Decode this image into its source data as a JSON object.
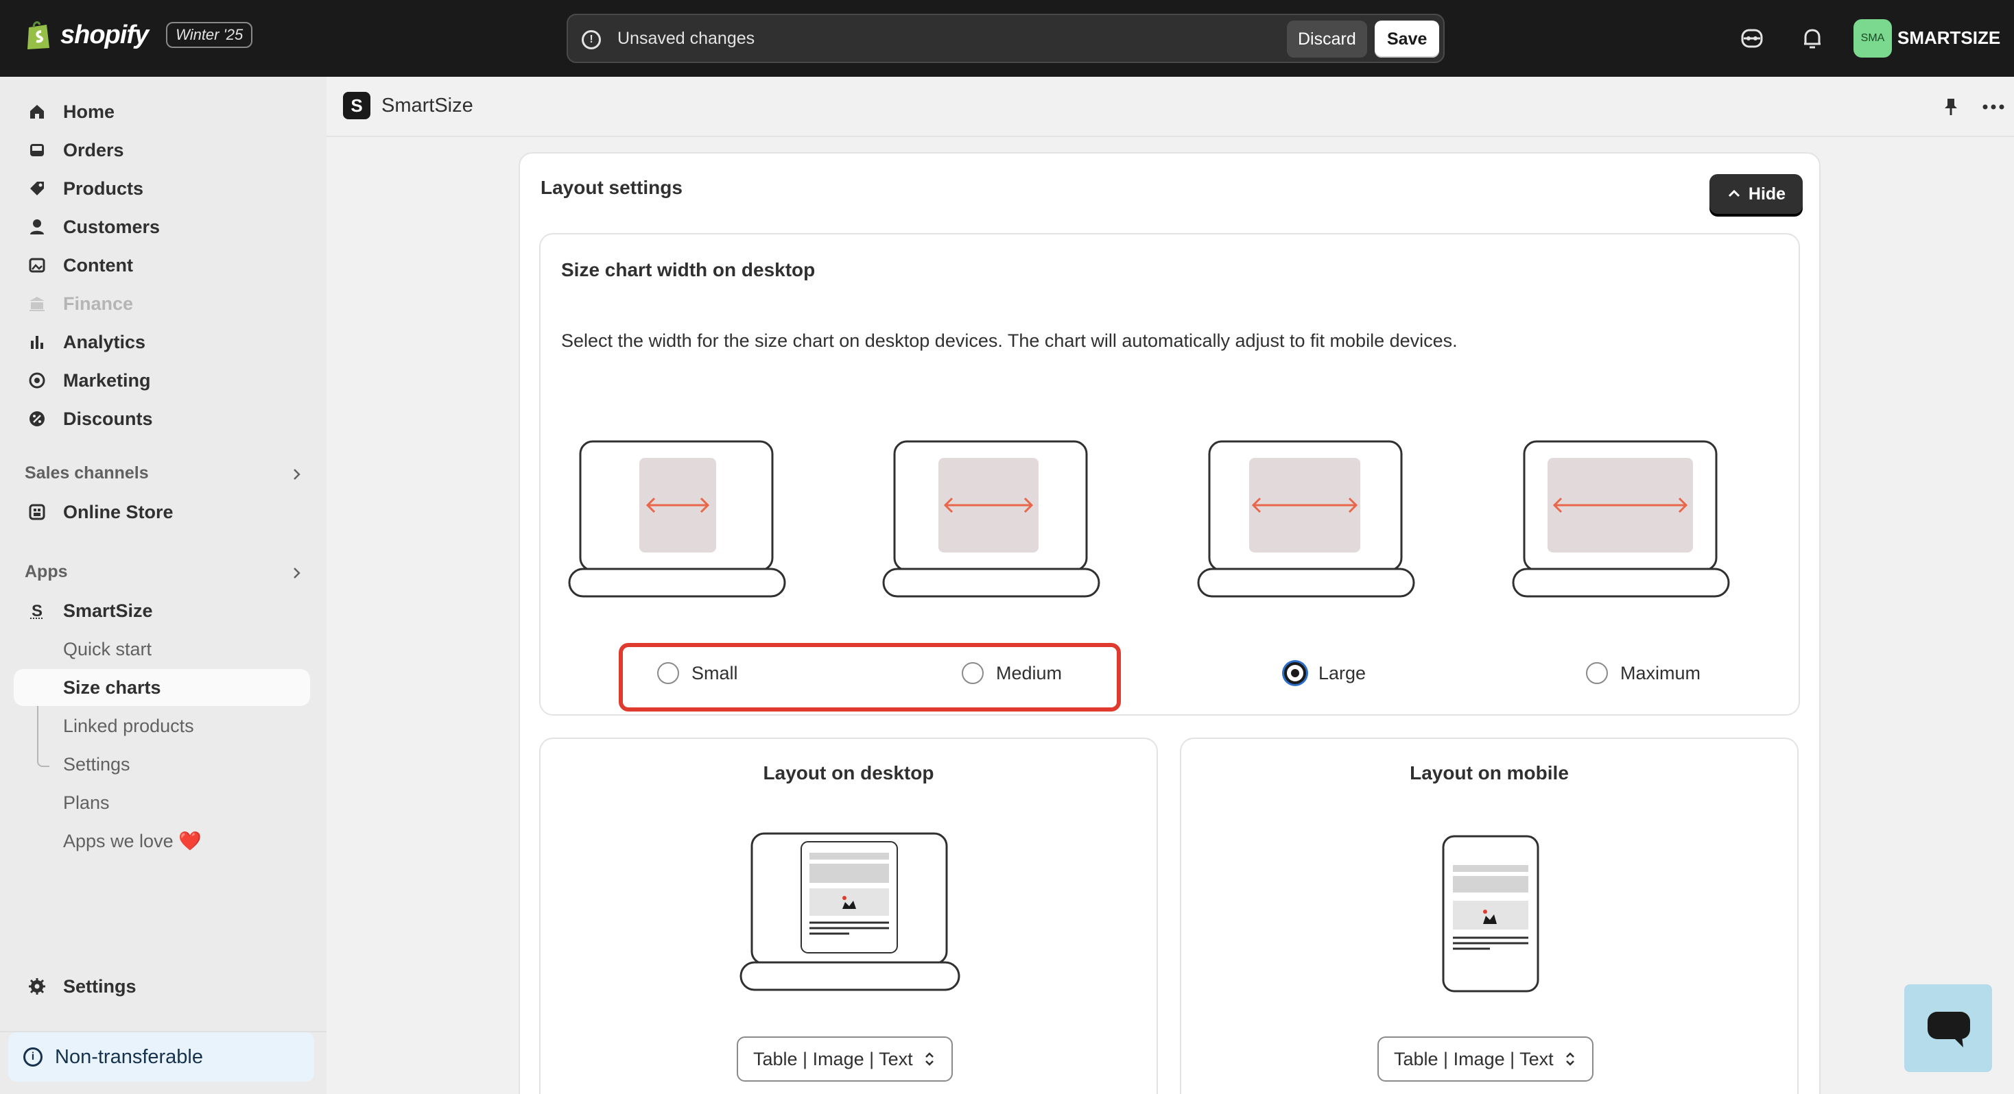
{
  "topbar": {
    "brand": "shopify",
    "edition_badge": "Winter '25",
    "unsaved_text": "Unsaved changes",
    "discard_label": "Discard",
    "save_label": "Save",
    "avatar_initials": "SMA",
    "store_name": "SMARTSIZE"
  },
  "sidebar": {
    "main_items": [
      {
        "label": "Home",
        "icon": "home-icon"
      },
      {
        "label": "Orders",
        "icon": "inbox-icon"
      },
      {
        "label": "Products",
        "icon": "tag-icon"
      },
      {
        "label": "Customers",
        "icon": "person-icon"
      },
      {
        "label": "Content",
        "icon": "image-icon"
      },
      {
        "label": "Finance",
        "icon": "bank-icon",
        "disabled": true
      },
      {
        "label": "Analytics",
        "icon": "bar-chart-icon"
      },
      {
        "label": "Marketing",
        "icon": "target-icon"
      },
      {
        "label": "Discounts",
        "icon": "discount-icon"
      }
    ],
    "sales_channels_heading": "Sales channels",
    "online_store_label": "Online Store",
    "apps_heading": "Apps",
    "app_name": "SmartSize",
    "app_subitems": [
      "Quick start",
      "Size charts",
      "Linked products",
      "Settings",
      "Plans",
      "Apps we love ❤️"
    ],
    "active_subitem": "Size charts",
    "settings_label": "Settings",
    "non_transferable_label": "Non-transferable"
  },
  "appbar": {
    "title": "SmartSize"
  },
  "layout_settings": {
    "title": "Layout settings",
    "hide_label": "Hide",
    "width_card": {
      "title": "Size chart width on desktop",
      "description": "Select the width for the size chart on desktop devices. The chart will automatically adjust to fit mobile devices.",
      "options": [
        "Small",
        "Medium",
        "Large",
        "Maximum"
      ],
      "selected": "Large"
    },
    "desktop_card": {
      "title": "Layout on desktop",
      "select_value": "Table | Image | Text"
    },
    "mobile_card": {
      "title": "Layout on mobile",
      "select_value": "Table | Image | Text"
    }
  },
  "colors": {
    "topbar_bg": "#1a1a1a",
    "accent_arrow": "#e8674a",
    "highlight_red": "#e03a2e",
    "chart_fill": "#e2dada"
  }
}
